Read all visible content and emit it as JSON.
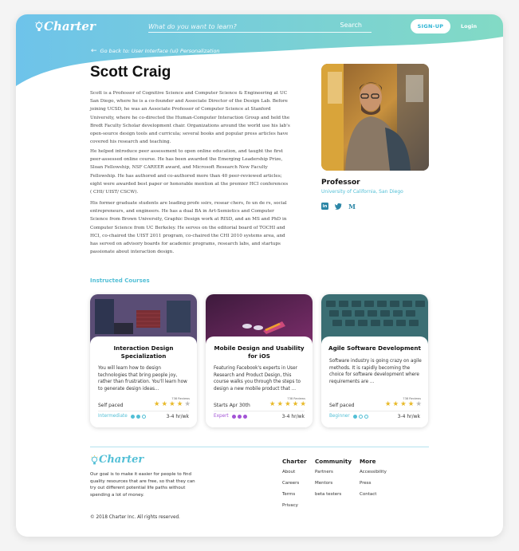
{
  "header": {
    "logo": "Charter",
    "search_placeholder": "What do you want to learn?",
    "search_button": "Search",
    "signup": "SIGN-UP",
    "login": "Login"
  },
  "back_link": "Go back to: User Interface (ui) Personalization",
  "profile": {
    "name": "Scott Craig",
    "bio": [
      "Scott is a Professor of Cognitive Science and Computer Science & Engineering at UC San Diego, where he is a co-founder and Associate Director of the Design Lab. Before joining UCSD, he was an Associate Professor of Computer Science at Stanford University, where he co-directed the Human-Computer Interaction Group and held the Bredt Faculty Scholar development chair. Organizations around the world use his lab's open-source design tools and curricula; several books and popular press articles have covered his research and teaching.",
      "He helped introduce peer assessment to open online education, and taught the first peer-assessed online course. He has been awarded the  Emerging Leadership Prize, Sloan Fellowship, NSF CAREER award, and Microsoft Research New Faculty Fellowship. He has authored and co-authored more than 40 peer-reviewed articles; eight were awarded best paper or honorable mention at the premier HCI conferences ( CHI/ UIST/ CSCW).",
      "His former graduate students are leading profe ssirs, resear chers, fo un de rs, social entrepreneurs, and engineers. He has a dual BA in Art-Semiotics and Computer Science from Brown University, Graphic Design work at RISD, and an MS and PhD in Computer Science from UC Berkeley. He serves on the editorial board of TOCHI and HCI, co-chaired the UIST 2011 program, co-chaired the CHI 2010 systems area, and has served on advisory boards for academic programs, research labs, and startups passionate about interaction design."
    ],
    "role": "Professor",
    "university": "University of California, San Diego",
    "socials": [
      "linkedin-icon",
      "twitter-icon",
      "medium-icon"
    ]
  },
  "courses_title": "Instructed Courses",
  "courses": [
    {
      "title": "Interaction Design Specialization",
      "description": "You will learn how to design technologies that bring people joy, rather than frustration. You'll learn how to generate design ideas...",
      "reviews": "738 Reviews",
      "sub": "Self paced",
      "rating": 4,
      "level": "Intermediate",
      "level_filled": 2,
      "level_color": "#52bfd6",
      "hours": "3-4 hr/wk"
    },
    {
      "title": "Mobile Design and Usability for iOS",
      "description": "Featuring Facebook's experts in User Research and Product Design, this course walks you through the steps to design a new mobile product that ...",
      "reviews": "738 Reviews",
      "sub": "Starts Apr 30th",
      "rating": 5,
      "level": "Expert",
      "level_filled": 3,
      "level_color": "#a353d6",
      "hours": "3-4 hr/wk"
    },
    {
      "title": "Agile Software Development",
      "description": "Software industry is going crazy on agile methods.  It is rapidly becoming the choice for software development where requirements are ...",
      "reviews": "738 Reviews",
      "sub": "Self paced",
      "rating": 4,
      "level": "Beginner",
      "level_filled": 1,
      "level_color": "#52bfd6",
      "hours": "3-4 hr/wk"
    }
  ],
  "footer": {
    "logo": "Charter",
    "description": "Our goal is to make it easier for people to find quality resources that are free, so that they can try out different potential life paths without spending a lot of money.",
    "copyright": "© 2018 Charter Inc. All rights reserved.",
    "columns": [
      {
        "title": "Charter",
        "links": [
          "About",
          "Careers",
          "Terms",
          "Privacy"
        ]
      },
      {
        "title": "Community",
        "links": [
          "Partners",
          "Mentors",
          "beta testers"
        ]
      },
      {
        "title": "More",
        "links": [
          "Accessibility",
          "Press",
          "Contact"
        ]
      }
    ]
  },
  "colors": {
    "accent": "#52bfd6",
    "gradient_left": "#6fc4e9",
    "gradient_right": "#7fd8c6",
    "star": "#e8b928",
    "star_empty": "#bbbbbb",
    "expert": "#a353d6"
  }
}
